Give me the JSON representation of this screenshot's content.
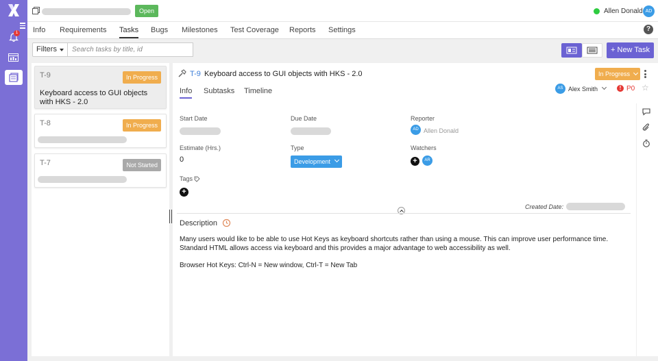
{
  "rail": {
    "notification_count": "1"
  },
  "header": {
    "status_badge": "Open",
    "user_name": "Allen Donald",
    "user_initials": "AD"
  },
  "nav": {
    "tabs": [
      "Info",
      "Requirements",
      "Tasks",
      "Bugs",
      "Milestones",
      "Test Coverage",
      "Reports",
      "Settings"
    ],
    "active": "Tasks"
  },
  "toolbar": {
    "filters_label": "Filters",
    "search_placeholder": "Search tasks by title, id",
    "new_task_label": "+ New Task"
  },
  "tasks": [
    {
      "id": "T-9",
      "status": "In Progress",
      "title": "Keyboard access to GUI objects with HKS - 2.0"
    },
    {
      "id": "T-8",
      "status": "In Progress",
      "title": ""
    },
    {
      "id": "T-7",
      "status": "Not Started",
      "title": ""
    }
  ],
  "detail": {
    "id": "T-9",
    "title": "Keyboard access to GUI objects with HKS - 2.0",
    "status": "In Progress",
    "tabs": [
      "Info",
      "Subtasks",
      "Timeline"
    ],
    "assignee_initials": "AS",
    "assignee_name": "Alex Smith",
    "priority": "P0",
    "labels": {
      "start_date": "Start Date",
      "due_date": "Due Date",
      "reporter": "Reporter",
      "estimate": "Estimate (Hrs.)",
      "type": "Type",
      "watchers": "Watchers",
      "tags": "Tags",
      "created_date": "Created Date:",
      "description": "Description"
    },
    "reporter_initials": "AD",
    "reporter_name": "Allen Donald",
    "estimate_value": "0",
    "type_value": "Development",
    "watcher_initials": "AR",
    "description_line1": "Many users would like to be able to use Hot Keys as keyboard shortcuts rather than using a mouse. This can improve user performance time.",
    "description_line2": "Standard HTML allows access via keyboard and this provides a major advantage to web accessibility as well.",
    "description_line3": "Browser Hot Keys: Ctrl-N = New window, Ctrl-T = New Tab"
  },
  "colors": {
    "rail": "#7b6fd6",
    "accent": "#6b62d3",
    "in_progress": "#f0ad4e",
    "open": "#5cb85c",
    "info_blue": "#3b9ce6",
    "priority_red": "#e53935"
  }
}
